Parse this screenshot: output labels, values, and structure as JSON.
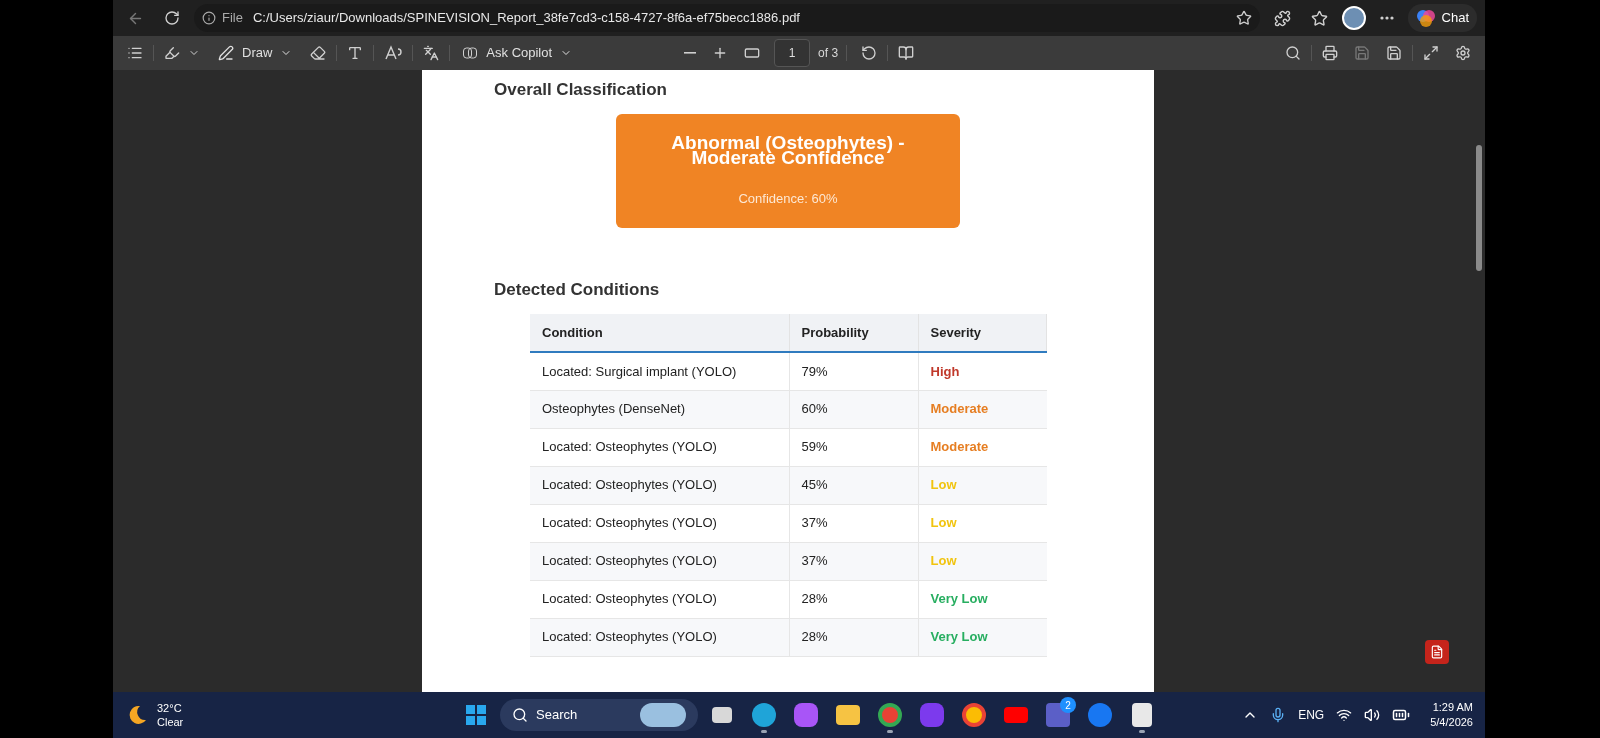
{
  "browser": {
    "address_prefix": "File",
    "url": "C:/Users/ziaur/Downloads/SPINEVISION_Report_38fe7cd3-c158-4727-8f6a-ef75becc1886.pdf",
    "chat_label": "Chat"
  },
  "pdf_toolbar": {
    "draw_label": "Draw",
    "copilot_label": "Ask Copilot",
    "page_number": "1",
    "page_count": "of 3"
  },
  "document": {
    "classification_heading": "Overall Classification",
    "classification_card": {
      "title": "Abnormal (Osteophytes) - Moderate Confidence",
      "confidence": "Confidence: 60%"
    },
    "conditions_heading": "Detected Conditions",
    "table": {
      "columns": [
        "Condition",
        "Probability",
        "Severity"
      ],
      "rows": [
        {
          "condition": "Located: Surgical implant (YOLO)",
          "probability": "79%",
          "severity": "High",
          "color": "#c0392b"
        },
        {
          "condition": "Osteophytes (DenseNet)",
          "probability": "60%",
          "severity": "Moderate",
          "color": "#e67e22"
        },
        {
          "condition": "Located: Osteophytes (YOLO)",
          "probability": "59%",
          "severity": "Moderate",
          "color": "#e67e22"
        },
        {
          "condition": "Located: Osteophytes (YOLO)",
          "probability": "45%",
          "severity": "Low",
          "color": "#f1c40f"
        },
        {
          "condition": "Located: Osteophytes (YOLO)",
          "probability": "37%",
          "severity": "Low",
          "color": "#f1c40f"
        },
        {
          "condition": "Located: Osteophytes (YOLO)",
          "probability": "37%",
          "severity": "Low",
          "color": "#f1c40f"
        },
        {
          "condition": "Located: Osteophytes (YOLO)",
          "probability": "28%",
          "severity": "Very Low",
          "color": "#27ae60"
        },
        {
          "condition": "Located: Osteophytes (YOLO)",
          "probability": "28%",
          "severity": "Very Low",
          "color": "#27ae60"
        }
      ]
    }
  },
  "taskbar": {
    "temperature": "32°C",
    "weather": "Clear",
    "search_label": "Search",
    "teams_badge": "2",
    "language": "ENG",
    "time": "1:29 AM",
    "date": "5/4/2026"
  }
}
